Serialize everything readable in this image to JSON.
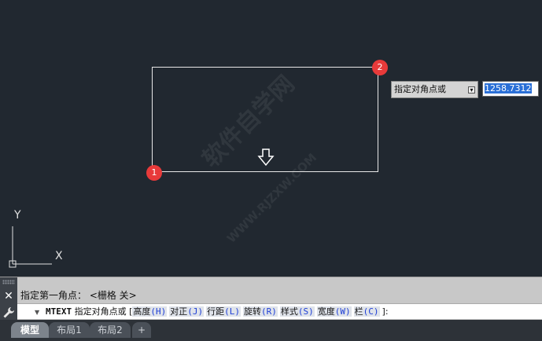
{
  "canvas": {
    "marker1": "1",
    "marker2": "2",
    "watermark": "软件自学网",
    "watermark_url": "WWW.RJZXW.COM"
  },
  "dynamic_input": {
    "prompt": "指定对角点或",
    "value": "1258.7312"
  },
  "ucs": {
    "x_label": "X",
    "y_label": "Y"
  },
  "command_line": {
    "history": "指定第一角点：  <栅格 关>",
    "command": "MTEXT",
    "prompt": "指定对角点或",
    "open_bracket": "[",
    "options": [
      {
        "label": "高度",
        "key": "(H)"
      },
      {
        "label": "对正",
        "key": "(J)"
      },
      {
        "label": "行距",
        "key": "(L)"
      },
      {
        "label": "旋转",
        "key": "(R)"
      },
      {
        "label": "样式",
        "key": "(S)"
      },
      {
        "label": "宽度",
        "key": "(W)"
      },
      {
        "label": "栏",
        "key": "(C)"
      }
    ],
    "close": "]:"
  },
  "tabs": [
    {
      "label": "模型",
      "active": true
    },
    {
      "label": "布局1",
      "active": false
    },
    {
      "label": "布局2",
      "active": false
    },
    {
      "label": "+",
      "active": false
    }
  ],
  "colors": {
    "canvas_bg": "#212830",
    "marker": "#e83a3a",
    "selection": "#2a6fd6"
  }
}
